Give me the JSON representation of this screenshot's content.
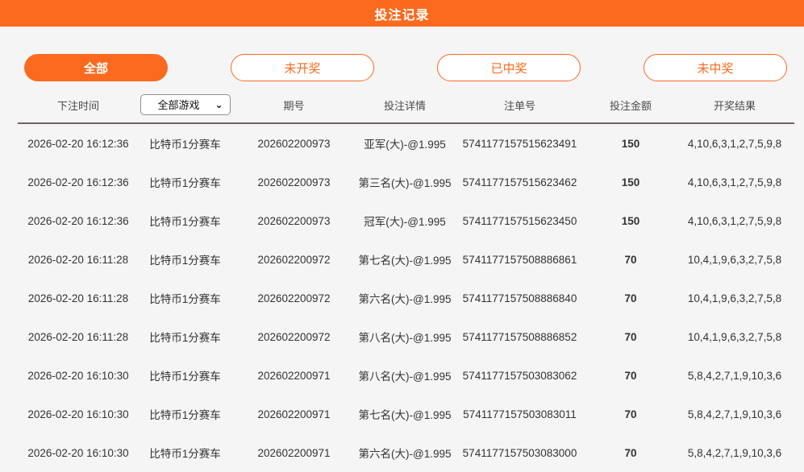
{
  "header": {
    "title": "投注记录"
  },
  "colors": {
    "accent_orange": "#fb6a1e",
    "highlight_red": "#f20d0d",
    "page_background": "#f5f5f6"
  },
  "filters": [
    {
      "label": "全部",
      "active": true
    },
    {
      "label": "未开奖",
      "active": false
    },
    {
      "label": "已中奖",
      "active": false
    },
    {
      "label": "未中奖",
      "active": false
    }
  ],
  "game_select": {
    "selected": "全部游戏",
    "chevron_icon": "⌄"
  },
  "table": {
    "columns": {
      "time": "下注时间",
      "period": "期号",
      "detail": "投注详情",
      "order": "注单号",
      "amount": "投注金额",
      "result": "开奖结果"
    },
    "rows": [
      {
        "time": "2026-02-20 16:12:36",
        "game": "比特币1分赛车",
        "period": "202602200973",
        "detail": "亚军(大)-@1.995",
        "order": "5741177157515623491",
        "amount": "150",
        "result": "4,10,6,3,1,2,7,5,9,8"
      },
      {
        "time": "2026-02-20 16:12:36",
        "game": "比特币1分赛车",
        "period": "202602200973",
        "detail": "第三名(大)-@1.995",
        "order": "5741177157515623462",
        "amount": "150",
        "result": "4,10,6,3,1,2,7,5,9,8"
      },
      {
        "time": "2026-02-20 16:12:36",
        "game": "比特币1分赛车",
        "period": "202602200973",
        "detail": "冠军(大)-@1.995",
        "order": "5741177157515623450",
        "amount": "150",
        "result": "4,10,6,3,1,2,7,5,9,8"
      },
      {
        "time": "2026-02-20 16:11:28",
        "game": "比特币1分赛车",
        "period": "202602200972",
        "detail": "第七名(大)-@1.995",
        "order": "5741177157508886861",
        "amount": "70",
        "result": "10,4,1,9,6,3,2,7,5,8"
      },
      {
        "time": "2026-02-20 16:11:28",
        "game": "比特币1分赛车",
        "period": "202602200972",
        "detail": "第六名(大)-@1.995",
        "order": "5741177157508886840",
        "amount": "70",
        "result": "10,4,1,9,6,3,2,7,5,8"
      },
      {
        "time": "2026-02-20 16:11:28",
        "game": "比特币1分赛车",
        "period": "202602200972",
        "detail": "第八名(大)-@1.995",
        "order": "5741177157508886852",
        "amount": "70",
        "result": "10,4,1,9,6,3,2,7,5,8"
      },
      {
        "time": "2026-02-20 16:10:30",
        "game": "比特币1分赛车",
        "period": "202602200971",
        "detail": "第八名(大)-@1.995",
        "order": "5741177157503083062",
        "amount": "70",
        "result": "5,8,4,2,7,1,9,10,3,6"
      },
      {
        "time": "2026-02-20 16:10:30",
        "game": "比特币1分赛车",
        "period": "202602200971",
        "detail": "第七名(大)-@1.995",
        "order": "5741177157503083011",
        "amount": "70",
        "result": "5,8,4,2,7,1,9,10,3,6"
      },
      {
        "time": "2026-02-20 16:10:30",
        "game": "比特币1分赛车",
        "period": "202602200971",
        "detail": "第六名(大)-@1.995",
        "order": "5741177157503083000",
        "amount": "70",
        "result": "5,8,4,2,7,1,9,10,3,6"
      }
    ]
  }
}
